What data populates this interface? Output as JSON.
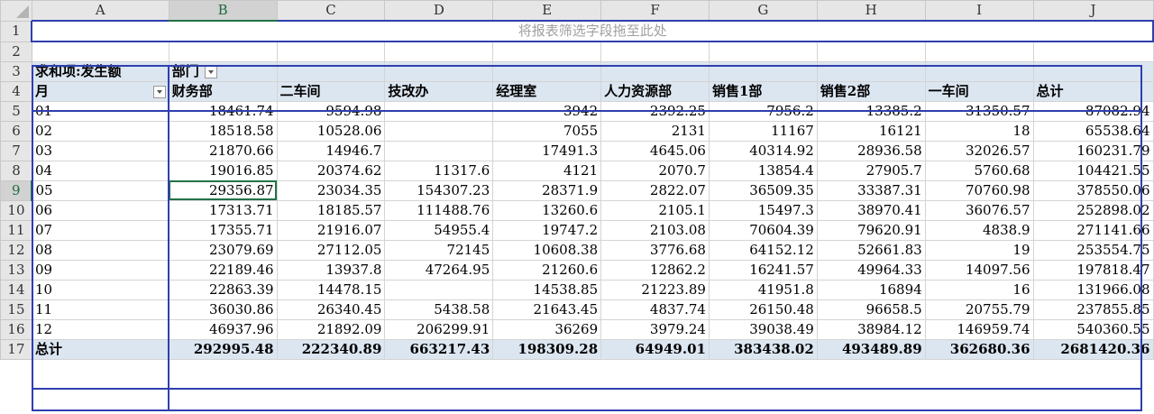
{
  "columns": [
    "A",
    "B",
    "C",
    "D",
    "E",
    "F",
    "G",
    "H",
    "I",
    "J"
  ],
  "row_numbers": [
    "1",
    "2",
    "3",
    "4",
    "5",
    "6",
    "7",
    "8",
    "9",
    "10",
    "11",
    "12",
    "13",
    "14",
    "15",
    "16",
    "17"
  ],
  "filter_zone_text": "将报表筛选字段拖至此处",
  "pivot": {
    "value_field": "求和项:发生额",
    "column_field": "部门",
    "row_field": "月",
    "headers": [
      "财务部",
      "二车间",
      "技改办",
      "经理室",
      "人力资源部",
      "销售1部",
      "销售2部",
      "一车间",
      "总计"
    ],
    "rows": [
      {
        "label": "01",
        "values": [
          "18461.74",
          "9594.98",
          "",
          "3942",
          "2392.25",
          "7956.2",
          "13385.2",
          "31350.57",
          "87082.94"
        ]
      },
      {
        "label": "02",
        "values": [
          "18518.58",
          "10528.06",
          "",
          "7055",
          "2131",
          "11167",
          "16121",
          "18",
          "65538.64"
        ]
      },
      {
        "label": "03",
        "values": [
          "21870.66",
          "14946.7",
          "",
          "17491.3",
          "4645.06",
          "40314.92",
          "28936.58",
          "32026.57",
          "160231.79"
        ]
      },
      {
        "label": "04",
        "values": [
          "19016.85",
          "20374.62",
          "11317.6",
          "4121",
          "2070.7",
          "13854.4",
          "27905.7",
          "5760.68",
          "104421.55"
        ]
      },
      {
        "label": "05",
        "values": [
          "29356.87",
          "23034.35",
          "154307.23",
          "28371.9",
          "2822.07",
          "36509.35",
          "33387.31",
          "70760.98",
          "378550.06"
        ]
      },
      {
        "label": "06",
        "values": [
          "17313.71",
          "18185.57",
          "111488.76",
          "13260.6",
          "2105.1",
          "15497.3",
          "38970.41",
          "36076.57",
          "252898.02"
        ]
      },
      {
        "label": "07",
        "values": [
          "17355.71",
          "21916.07",
          "54955.4",
          "19747.2",
          "2103.08",
          "70604.39",
          "79620.91",
          "4838.9",
          "271141.66"
        ]
      },
      {
        "label": "08",
        "values": [
          "23079.69",
          "27112.05",
          "72145",
          "10608.38",
          "3776.68",
          "64152.12",
          "52661.83",
          "19",
          "253554.75"
        ]
      },
      {
        "label": "09",
        "values": [
          "22189.46",
          "13937.8",
          "47264.95",
          "21260.6",
          "12862.2",
          "16241.57",
          "49964.33",
          "14097.56",
          "197818.47"
        ]
      },
      {
        "label": "10",
        "values": [
          "22863.39",
          "14478.15",
          "",
          "14538.85",
          "21223.89",
          "41951.8",
          "16894",
          "16",
          "131966.08"
        ]
      },
      {
        "label": "11",
        "values": [
          "36030.86",
          "26340.45",
          "5438.58",
          "21643.45",
          "4837.74",
          "26150.48",
          "96658.5",
          "20755.79",
          "237855.85"
        ]
      },
      {
        "label": "12",
        "values": [
          "46937.96",
          "21892.09",
          "206299.91",
          "36269",
          "3979.24",
          "39038.49",
          "38984.12",
          "146959.74",
          "540360.55"
        ]
      }
    ],
    "total_label": "总计",
    "totals": [
      "292995.48",
      "222340.89",
      "663217.43",
      "198309.28",
      "64949.01",
      "383438.02",
      "493489.89",
      "362680.36",
      "2681420.36"
    ]
  },
  "colors": {
    "header_bg": "#e6e6e6",
    "pivot_header_bg": "#dce6f1",
    "pivot_border": "#2e3fae",
    "selection": "#217346"
  }
}
